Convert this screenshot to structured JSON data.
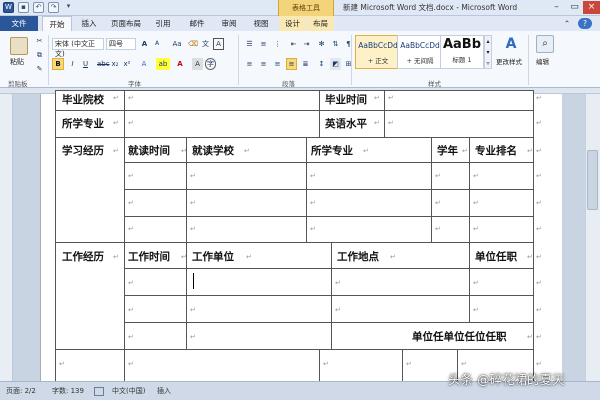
{
  "titlebar": {
    "context_tab": "表格工具",
    "document_title": "新建 Microsoft Word 文档.docx - Microsoft Word"
  },
  "tabs": [
    {
      "label": "文件"
    },
    {
      "label": "开始"
    },
    {
      "label": "插入"
    },
    {
      "label": "页面布局"
    },
    {
      "label": "引用"
    },
    {
      "label": "邮件"
    },
    {
      "label": "审阅"
    },
    {
      "label": "视图"
    },
    {
      "label": "设计"
    },
    {
      "label": "布局"
    }
  ],
  "ribbon": {
    "paste_label": "粘贴",
    "font_name": "宋体 (中文正文)",
    "font_size": "四号",
    "grow_font": "A",
    "shrink_font": "A",
    "change_case": "Aa",
    "bold": "B",
    "italic": "I",
    "underline": "U",
    "font_color_icon": "A",
    "styles": [
      {
        "sample": "AaBbCcDd",
        "name": "+ 正文"
      },
      {
        "sample": "AaBbCcDd",
        "name": "+ 无间隔"
      },
      {
        "sample": "AaBb",
        "name": "标题 1"
      }
    ],
    "change_styles_label": "更改样式",
    "editing_label": "编辑",
    "group_clipboard": "剪贴板",
    "group_font": "字体",
    "group_paragraph": "段落",
    "group_styles": "样式"
  },
  "table": {
    "grad_school": "毕业院校",
    "grad_time": "毕业时间",
    "major": "所学专业",
    "english_level": "英语水平",
    "study_history": "学习经历",
    "study_period": "就读时间",
    "study_school": "就读学校",
    "study_major": "所学专业",
    "degree": "学年",
    "rank": "专业排名",
    "work_history": "工作经历",
    "work_period": "工作时间",
    "work_unit": "工作单位",
    "work_place": "工作地点",
    "position": "单位任职",
    "repeated_text": "单位任单位任位任职",
    "mark": "↵"
  },
  "statusbar": {
    "page": "页面: 2/2",
    "words": "字数: 139",
    "language": "中文(中国)",
    "mode": "插入"
  },
  "watermark": "头条 @碎花裙的夏天",
  "colors": {
    "file_tab": "#2b579a",
    "context_tab": "#f3d47b",
    "ribbon_bg": "#f5f8fc",
    "highlight": "#f9d87a",
    "font_color_red": "#d00000"
  }
}
